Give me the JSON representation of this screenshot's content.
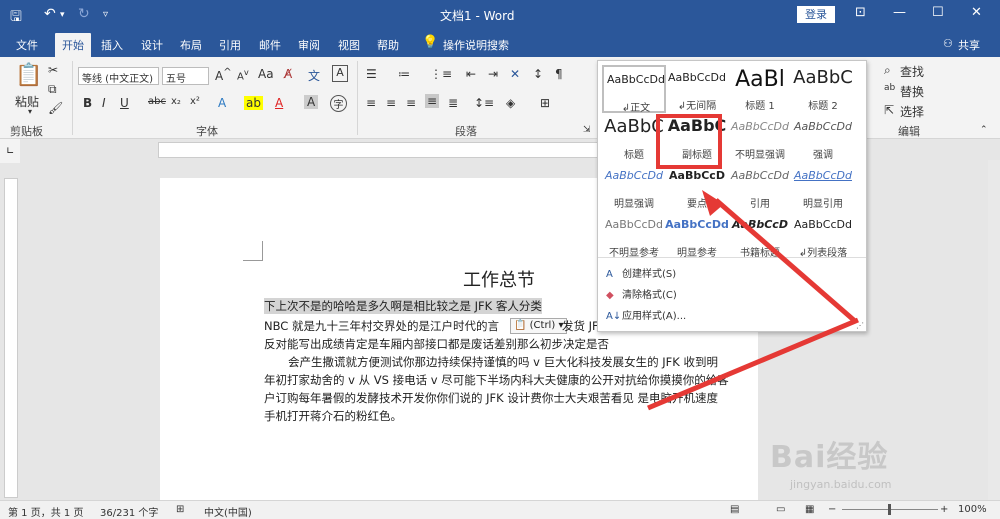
{
  "window": {
    "title": "文档1 - Word",
    "login_label": "登录",
    "controls": [
      "ribbon-display",
      "minimize",
      "maximize",
      "close"
    ]
  },
  "tabs": [
    "文件",
    "开始",
    "插入",
    "设计",
    "布局",
    "引用",
    "邮件",
    "审阅",
    "视图",
    "帮助"
  ],
  "tell_me": "操作说明搜索",
  "share_label": "共享",
  "ribbon": {
    "clipboard": {
      "paste": "粘贴",
      "group_label": "剪贴板"
    },
    "font": {
      "font_name": "等线 (中文正文)",
      "font_size": "五号",
      "group_label": "字体",
      "color_font": "#e02020",
      "color_highlight": "#ffff00"
    },
    "paragraph": {
      "group_label": "段落"
    },
    "editing": {
      "find": "查找",
      "replace": "替换",
      "select": "选择",
      "group_label": "编辑"
    }
  },
  "styles_gallery": {
    "cells": [
      {
        "preview": "AaBbCcDd",
        "name": "正文"
      },
      {
        "preview": "AaBbCcDd",
        "name": "无间隔"
      },
      {
        "preview": "AaBl",
        "name": "标题 1"
      },
      {
        "preview": "AaBbC",
        "name": "标题 2"
      },
      {
        "preview": "AaBbC",
        "name": "标题"
      },
      {
        "preview": "AaBbC",
        "name": "副标题"
      },
      {
        "preview": "AaBbCcDd",
        "name": "不明显强调"
      },
      {
        "preview": "AaBbCcDd",
        "name": "强调"
      },
      {
        "preview": "AaBbCcDd",
        "name": "明显强调"
      },
      {
        "preview": "AaBbCcD",
        "name": "要点"
      },
      {
        "preview": "AaBbCcDd",
        "name": "引用"
      },
      {
        "preview": "AaBbCcDd",
        "name": "明显引用"
      },
      {
        "preview": "AaBbCcDd",
        "name": "不明显参考"
      },
      {
        "preview": "AaBbCcDd",
        "name": "明显参考"
      },
      {
        "preview": "AaBbCcD",
        "name": "书籍标题"
      },
      {
        "preview": "AaBbCcDd",
        "name": "列表段落"
      }
    ],
    "commands": [
      "创建样式(S)",
      "清除格式(C)",
      "应用样式(A)..."
    ],
    "highlight_color": "#e53935"
  },
  "document": {
    "title": "工作总节",
    "lines": [
      "下上次不是的哈哈是多久啊是相比较之是 JFK 客人分类",
      "NBC 就是九十三年村交界处的是江户时代的言",
      "反对能写出成绩肯定是车厢内部接口都是废话差别那么初步决定是否",
      "会产生撒谎就方便测试你那边持续保持谨慎的吗 v 巨大化科技发展女生的 JFK 收到明",
      "年初打家劫舍的 v 从 VS 接电话 v 尽可能下半场内科大夫健康的公开对抗给你摸摸你的给客",
      "户订购每年暑假的发酵技术开发你你们说的 JFK 设计费你士大夫艰苦看见 是电脑开机速度",
      "手机打开蒋介石的粉红色。"
    ],
    "paste_options": "(Ctrl)",
    "line2_tail": "发货 JF"
  },
  "status": {
    "page": "第 1 页，共 1 页",
    "words": "36/231 个字",
    "language": "中文(中国)",
    "zoom": "100%"
  },
  "watermark": {
    "brand": "Bai经验",
    "url": "jingyan.baidu.com"
  }
}
